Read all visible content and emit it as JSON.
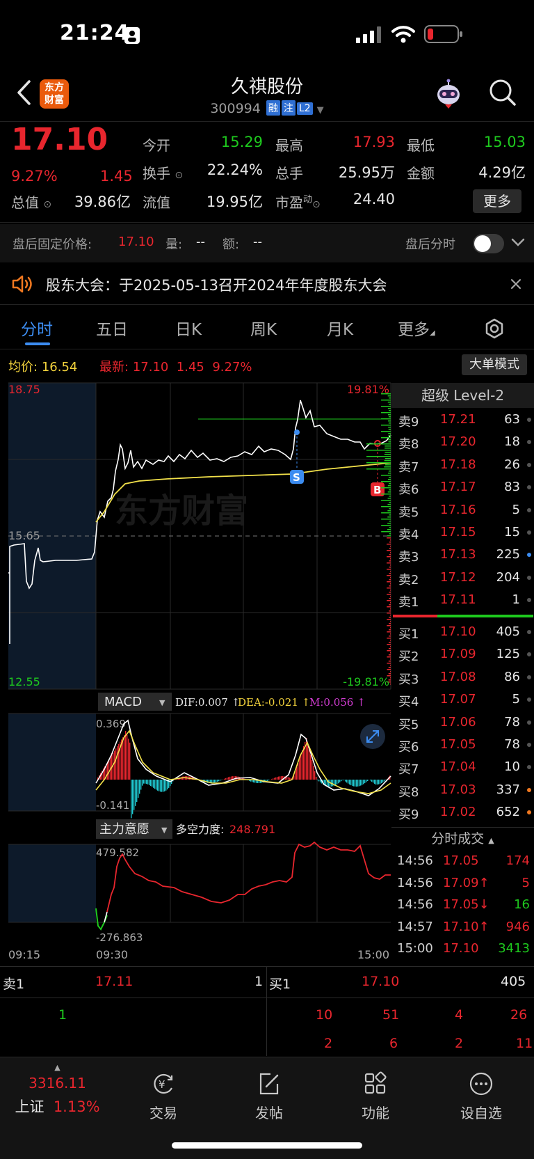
{
  "status": {
    "time": "21:24"
  },
  "nav": {
    "logo_text_1": "东方",
    "logo_text_2": "财富",
    "title": "久祺股份",
    "code": "300994",
    "tags": [
      "融",
      "注",
      "L2"
    ]
  },
  "quote": {
    "price": "17.10",
    "change_pct": "9.27%",
    "change": "1.45",
    "fields": [
      {
        "label": "今开",
        "value": "15.29",
        "color": "green"
      },
      {
        "label": "最高",
        "value": "17.93",
        "color": "red"
      },
      {
        "label": "最低",
        "value": "15.03",
        "color": "green"
      },
      {
        "label": "换手",
        "value": "22.24%",
        "color": "white"
      },
      {
        "label": "总手",
        "value": "25.95万",
        "color": "white"
      },
      {
        "label": "金额",
        "value": "4.29亿",
        "color": "white"
      },
      {
        "label": "总值",
        "value": "39.86亿",
        "color": "white"
      },
      {
        "label": "流值",
        "value": "19.95亿",
        "color": "white"
      },
      {
        "label": "市盈",
        "value": "24.40",
        "color": "white"
      }
    ],
    "pe_suffix": "动",
    "more_label": "更多"
  },
  "after_hours": {
    "label": "盘后固定价格:",
    "price": "17.10",
    "qty_label": "量:",
    "qty": "--",
    "amt_label": "额:",
    "amt": "--",
    "toggle_label": "盘后分时"
  },
  "notice": {
    "text": "股东大会：于2025-05-13召开2024年年度股东大会"
  },
  "tabs": [
    "分时",
    "五日",
    "日K",
    "周K",
    "月K",
    "更多"
  ],
  "info": {
    "avg_label": "均价:",
    "avg_value": "16.54",
    "latest_label": "最新:",
    "latest_price": "17.10",
    "latest_change": "1.45",
    "latest_pct": "9.27%",
    "bigorder_label": "大单模式"
  },
  "chart": {
    "y_max": "18.75",
    "y_mid": "15.65",
    "y_min": "12.55",
    "pct_max": "19.81%",
    "pct_min": "-19.81%",
    "watermark": "东方财富",
    "marker_sell": "S",
    "marker_buy": "B",
    "macd_label": "MACD",
    "dif": "DIF:0.007 ↑",
    "dea": "DEA:-0.021 ↑",
    "m": "M:0.056 ↑",
    "macd_max": "0.369",
    "macd_min": "-0.141",
    "main_label": "主力意愿",
    "power_label": "多空力度:",
    "power_value": "248.791",
    "main_max": "479.582",
    "main_min": "-276.863",
    "x_labels": [
      "09:15",
      "09:30",
      "15:00"
    ]
  },
  "orderbook": {
    "title": "超级 Level-2",
    "asks": [
      {
        "label": "卖9",
        "price": "17.21",
        "vol": "63",
        "dot": "#555"
      },
      {
        "label": "卖8",
        "price": "17.20",
        "vol": "18",
        "dot": "#555"
      },
      {
        "label": "卖7",
        "price": "17.18",
        "vol": "26",
        "dot": "#555"
      },
      {
        "label": "卖6",
        "price": "17.17",
        "vol": "83",
        "dot": "#555"
      },
      {
        "label": "卖5",
        "price": "17.16",
        "vol": "5",
        "dot": "#555"
      },
      {
        "label": "卖4",
        "price": "17.15",
        "vol": "15",
        "dot": "#555"
      },
      {
        "label": "卖3",
        "price": "17.13",
        "vol": "225",
        "dot": "#3c8cf0"
      },
      {
        "label": "卖2",
        "price": "17.12",
        "vol": "204",
        "dot": "#555"
      },
      {
        "label": "卖1",
        "price": "17.11",
        "vol": "1",
        "dot": "#555"
      }
    ],
    "bids": [
      {
        "label": "买1",
        "price": "17.10",
        "vol": "405",
        "dot": "#555"
      },
      {
        "label": "买2",
        "price": "17.09",
        "vol": "125",
        "dot": "#555"
      },
      {
        "label": "买3",
        "price": "17.08",
        "vol": "86",
        "dot": "#555"
      },
      {
        "label": "买4",
        "price": "17.07",
        "vol": "5",
        "dot": "#555"
      },
      {
        "label": "买5",
        "price": "17.06",
        "vol": "78",
        "dot": "#555"
      },
      {
        "label": "买6",
        "price": "17.05",
        "vol": "78",
        "dot": "#555"
      },
      {
        "label": "买7",
        "price": "17.04",
        "vol": "10",
        "dot": "#555"
      },
      {
        "label": "买8",
        "price": "17.03",
        "vol": "337",
        "dot": "#f07820"
      },
      {
        "label": "买9",
        "price": "17.02",
        "vol": "652",
        "dot": "#f07820"
      }
    ],
    "ticks_title": "分时成交",
    "ticks": [
      {
        "time": "14:56",
        "price": "17.05",
        "vol": "174",
        "vcolor": "red"
      },
      {
        "time": "14:56",
        "price": "17.09↑",
        "vol": "5",
        "vcolor": "red"
      },
      {
        "time": "14:56",
        "price": "17.05↓",
        "vol": "16",
        "vcolor": "green"
      },
      {
        "time": "14:57",
        "price": "17.10↑",
        "vol": "946",
        "vcolor": "red"
      },
      {
        "time": "15:00",
        "price": "17.10",
        "vol": "3413",
        "vcolor": "green"
      }
    ]
  },
  "bottom_book": {
    "ask_label": "卖1",
    "ask_price": "17.11",
    "ask_vol": "1",
    "bid_label": "买1",
    "bid_price": "17.10",
    "bid_vol": "405",
    "ask_queue": [
      "1"
    ],
    "bid_queue_row1": [
      "10",
      "51",
      "4",
      "26"
    ],
    "bid_queue_row2": [
      "2",
      "6",
      "2",
      "11"
    ]
  },
  "tabbar": {
    "index_value": "3316.11",
    "index_name": "上证",
    "index_pct": "1.13%",
    "items": [
      "交易",
      "发帖",
      "功能",
      "设自选"
    ]
  }
}
